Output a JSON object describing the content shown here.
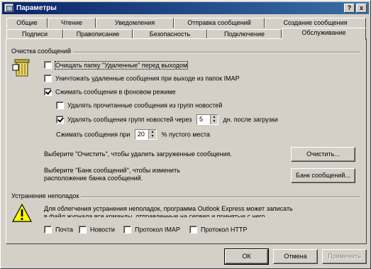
{
  "window": {
    "title": "Параметры",
    "help_btn": "?",
    "close_btn": "x"
  },
  "tabs_back": [
    "Общие",
    "Чтение",
    "Уведомления",
    "Отправка сообщений",
    "Создание сообщения"
  ],
  "tabs_front": [
    "Подписи",
    "Правописание",
    "Безопасность",
    "Подключение",
    "Обслуживание"
  ],
  "active_tab": "Обслуживание",
  "cleanup": {
    "group_title": "Очистка сообщений",
    "empty_deleted": {
      "label": "Очищать папку \"Удаленные\" перед выходом",
      "checked": false
    },
    "purge_imap": {
      "label": "Уничтожать удаленные сообщения при выходе из папок IMAP",
      "checked": false
    },
    "compact_bg": {
      "label": "Сжимать сообщения в фоновом режиме",
      "checked": true
    },
    "delete_read_news": {
      "label": "Удалять прочитанные сообщения из групп новостей",
      "checked": false
    },
    "delete_news_after": {
      "label": "Удалять сообщения групп новостей через",
      "checked": true,
      "value": "5",
      "suffix": "дн. после загрузки"
    },
    "compact_when": {
      "label": "Сжимать сообщения при",
      "value": "20",
      "suffix": "% пустого места"
    },
    "clean_text": "Выберите \"Очистить\", чтобы удалить загруженные сообщения.",
    "clean_button": "Очистить...",
    "store_text_1": "Выберите \"Банк сообщений\", чтобы изменить",
    "store_text_2": "расположение банка сообщений.",
    "store_button": "Банк сообщений..."
  },
  "troubleshoot": {
    "group_title": "Устранение неполадок",
    "text_1": "Для облегчения устранения неполадок, программа Outlook Express может записать",
    "text_2": "в файл журнала все команды, отправленные на сервер и принятые с него.",
    "options": [
      {
        "label": "Почта",
        "checked": false
      },
      {
        "label": "Новости",
        "checked": false
      },
      {
        "label": "Протокол IMAP",
        "checked": false
      },
      {
        "label": "Протокол HTTP",
        "checked": false
      }
    ]
  },
  "footer": {
    "ok": "ОК",
    "cancel": "Отмена",
    "apply": "Применить"
  }
}
